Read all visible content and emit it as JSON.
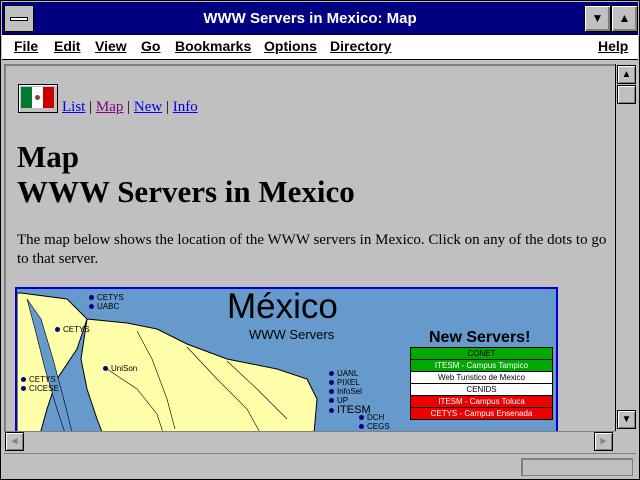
{
  "window": {
    "title": "WWW Servers in Mexico: Map"
  },
  "menu": {
    "file": "File",
    "edit": "Edit",
    "view": "View",
    "go": "Go",
    "bookmarks": "Bookmarks",
    "options": "Options",
    "directory": "Directory",
    "help": "Help"
  },
  "nav": {
    "list": "List",
    "sep1": "|",
    "map": "Map",
    "sep2": "|",
    "new": "New",
    "sep3": "|",
    "info": "Info"
  },
  "page": {
    "heading1": "Map",
    "heading2": "WWW Servers in Mexico",
    "paragraph": "The map below shows the location of the WWW servers in Mexico. Click on any of the dots to go to that server."
  },
  "map": {
    "title": "México",
    "subtitle": "WWW Servers",
    "new_servers_title": "New Servers!",
    "new_servers": [
      {
        "label": "CONET",
        "color": "#00aa00",
        "text": "#000000"
      },
      {
        "label": "ITESM - Campus Tampico",
        "color": "#00aa00",
        "text": "#ffffff"
      },
      {
        "label": "Web Turistico de Mexico",
        "color": "#ffffff",
        "text": "#000000"
      },
      {
        "label": "CENIDS",
        "color": "#ffffff",
        "text": "#000000"
      },
      {
        "label": "ITESM - Campus Toluca",
        "color": "#ee0000",
        "text": "#ffffff"
      },
      {
        "label": "CETYS - Campus Ensenada",
        "color": "#ee0000",
        "text": "#ffffff"
      }
    ],
    "sites": {
      "cetys1": "CETYS",
      "uabc": "UABC",
      "cetys2": "CETYS",
      "unison": "UniSon",
      "cetys3": "CETYS",
      "cicese": "CICESE",
      "uanl": "UANL",
      "pixel": "PIXEL",
      "infosel": "InfoSel",
      "up": "UP",
      "itesm": "ITESM",
      "dch": "DCH",
      "cegs": "CEGS"
    },
    "land_color": "#ffffaa",
    "sea_color": "#6699cc"
  }
}
